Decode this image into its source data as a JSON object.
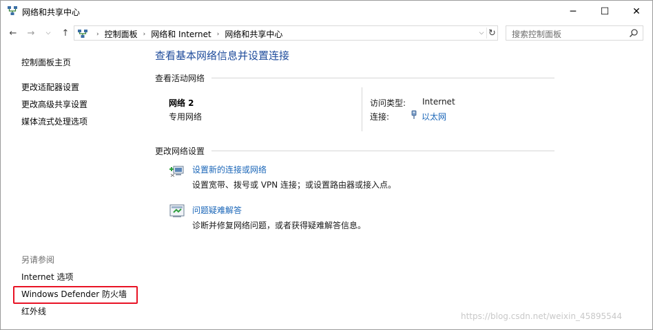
{
  "window": {
    "title": "网络和共享中心",
    "controls": {
      "minimize": "─",
      "maximize": "☐",
      "close": "✕"
    }
  },
  "nav": {
    "back": "←",
    "forward": "→",
    "recent": "⌵",
    "up": "↑",
    "breadcrumbs": [
      "控制面板",
      "网络和 Internet",
      "网络和共享中心"
    ],
    "crumb_separator": "›",
    "dropdown": "⌵",
    "refresh": "↻",
    "search_placeholder": "搜索控制面板"
  },
  "sidebar": {
    "items": [
      {
        "label": "控制面板主页"
      },
      {
        "label": "更改适配器设置"
      },
      {
        "label": "更改高级共享设置"
      },
      {
        "label": "媒体流式处理选项"
      }
    ],
    "see_also_label": "另请参阅",
    "see_also_items": [
      {
        "label": "Internet 选项"
      },
      {
        "label": "Windows Defender 防火墙"
      },
      {
        "label": "红外线"
      }
    ],
    "highlight_color": "#e81123"
  },
  "main": {
    "title": "查看基本网络信息并设置连接",
    "active_networks_title": "查看活动网络",
    "network": {
      "name": "网络 2",
      "category": "专用网络",
      "access_type_label": "访问类型:",
      "access_type_value": "Internet",
      "connections_label": "连接:",
      "connection_name": "以太网"
    },
    "change_settings_title": "更改网络设置",
    "tasks": [
      {
        "link": "设置新的连接或网络",
        "description": "设置宽带、拨号或 VPN 连接；或设置路由器或接入点。",
        "icon": "new-connection-icon"
      },
      {
        "link": "问题疑难解答",
        "description": "诊断并修复网络问题，或者获得疑难解答信息。",
        "icon": "troubleshoot-icon"
      }
    ],
    "link_color": "#1a66b8",
    "title_color": "#1e4b9b"
  },
  "watermark": "https://blog.csdn.net/weixin_45895544"
}
